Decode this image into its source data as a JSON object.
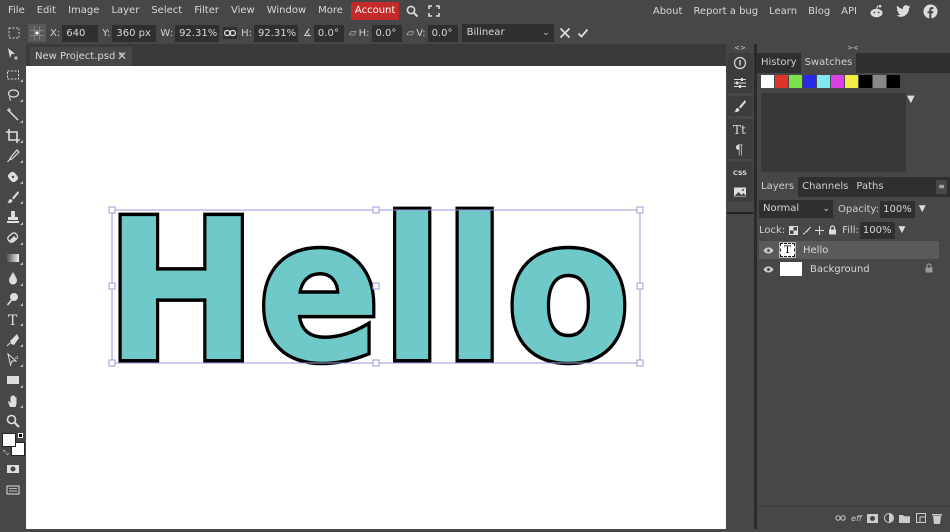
{
  "menubar": {
    "items": [
      "File",
      "Edit",
      "Image",
      "Layer",
      "Select",
      "Filter",
      "View",
      "Window",
      "More"
    ],
    "account": "Account",
    "icons": [
      "search-icon",
      "fullscreen-icon"
    ],
    "right_links": [
      "About",
      "Report a bug",
      "Learn",
      "Blog",
      "API"
    ],
    "social_icons": [
      "reddit-icon",
      "twitter-icon",
      "facebook-icon"
    ]
  },
  "options": {
    "x_label": "X:",
    "x_value": "640 px",
    "y_label": "Y:",
    "y_value": "360 px",
    "w_label": "W:",
    "w_value": "92.31%",
    "h_label": "H:",
    "h_value": "92.31%",
    "angle_value": "0.0°",
    "skew_h_label": "H:",
    "skew_h_value": "0.0°",
    "skew_v_label": "V:",
    "skew_v_value": "0.0°",
    "interpolation": "Bilinear"
  },
  "document": {
    "tab_title": "New Project.psd *",
    "text_layer_content": "Hello",
    "text_fill": "#6fc9c9",
    "text_stroke": "#000000"
  },
  "toolbar": {
    "tools": [
      "move-tool",
      "marquee-tool",
      "lasso-tool",
      "magic-wand-tool",
      "crop-tool",
      "eyedropper-tool",
      "healing-tool",
      "brush-tool",
      "clone-stamp-tool",
      "eraser-tool",
      "gradient-tool",
      "blur-tool",
      "dodge-tool",
      "type-tool",
      "pen-tool",
      "path-select-tool",
      "shape-tool",
      "hand-tool",
      "zoom-tool"
    ],
    "foreground_color": "#ffffff",
    "background_color": "#ffffff"
  },
  "side_panel_buttons": [
    "info",
    "adjustments",
    "brush",
    "character",
    "paragraph",
    "css",
    "image"
  ],
  "panels": {
    "top_tabs": [
      "History",
      "Swatches"
    ],
    "top_active": "Swatches",
    "swatches": [
      "#ffffff",
      "#e0332b",
      "#7de04d",
      "#2a2ae6",
      "#7fe8f3",
      "#d940e6",
      "#f3ee45",
      "#000000",
      "#888888",
      "#000000"
    ],
    "layer_tabs": [
      "Layers",
      "Channels",
      "Paths"
    ],
    "layer_active": "Layers",
    "blend_mode": "Normal",
    "opacity_label": "Opacity:",
    "opacity_value": "100%",
    "lock_label": "Lock:",
    "fill_label": "Fill:",
    "fill_value": "100%",
    "layers": [
      {
        "name": "Hello",
        "type": "text",
        "selected": true,
        "visible": true,
        "locked": false
      },
      {
        "name": "Background",
        "type": "raster",
        "selected": false,
        "visible": true,
        "locked": true
      }
    ],
    "footer_icons": [
      "link-layers-icon",
      "effects-icon",
      "mask-icon",
      "adjustment-layer-icon",
      "folder-icon",
      "new-layer-icon",
      "trash-icon"
    ]
  }
}
